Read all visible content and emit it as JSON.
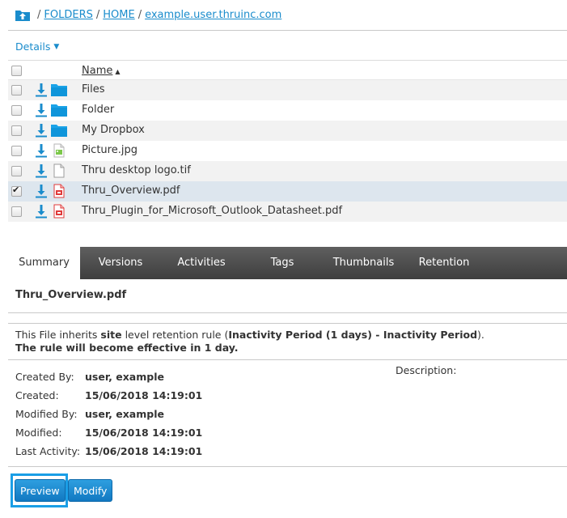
{
  "breadcrumb": {
    "icon": "folder-up-icon",
    "items": [
      "FOLDERS",
      "HOME",
      "example.user.thruinc.com"
    ],
    "separator": "/"
  },
  "details_label": "Details",
  "table": {
    "header": {
      "name_label": "Name",
      "sort": "ascending"
    },
    "rows": [
      {
        "name": "Files",
        "icon": "folder-icon",
        "checked": false
      },
      {
        "name": "Folder",
        "icon": "folder-icon",
        "checked": false
      },
      {
        "name": "My Dropbox",
        "icon": "folder-icon",
        "checked": false
      },
      {
        "name": "Picture.jpg",
        "icon": "image-file-icon",
        "checked": false
      },
      {
        "name": "Thru desktop logo.tif",
        "icon": "generic-file-icon",
        "checked": false
      },
      {
        "name": "Thru_Overview.pdf",
        "icon": "pdf-file-icon",
        "checked": true
      },
      {
        "name": "Thru_Plugin_for_Microsoft_Outlook_Datasheet.pdf",
        "icon": "pdf-file-icon",
        "checked": false
      }
    ]
  },
  "tabs": [
    "Summary",
    "Versions",
    "Activities",
    "Tags",
    "Thumbnails",
    "Retention"
  ],
  "active_tab": "Summary",
  "summary": {
    "file_title": "Thru_Overview.pdf",
    "retention": {
      "part1": "This File inherits ",
      "level": "site",
      "part2": " level retention rule (",
      "rule": "Inactivity Period (1 days) - Inactivity Period",
      "part3": ").",
      "effective": "The rule will become effective in 1 day."
    },
    "meta": [
      {
        "label": "Created By:",
        "value": "user, example"
      },
      {
        "label": "Created:",
        "value": "15/06/2018 14:19:01"
      },
      {
        "label": "Modified By:",
        "value": "user, example"
      },
      {
        "label": "Modified:",
        "value": "15/06/2018 14:19:01"
      },
      {
        "label": "Last Activity:",
        "value": "15/06/2018 14:19:01"
      }
    ],
    "description_label": "Description:"
  },
  "buttons": {
    "preview": "Preview",
    "modify": "Modify"
  },
  "colors": {
    "accent": "#1a8ccc",
    "button": "#1a86cf",
    "tab_bar": "#4a4a4a",
    "selected_row": "#dde6ee"
  }
}
